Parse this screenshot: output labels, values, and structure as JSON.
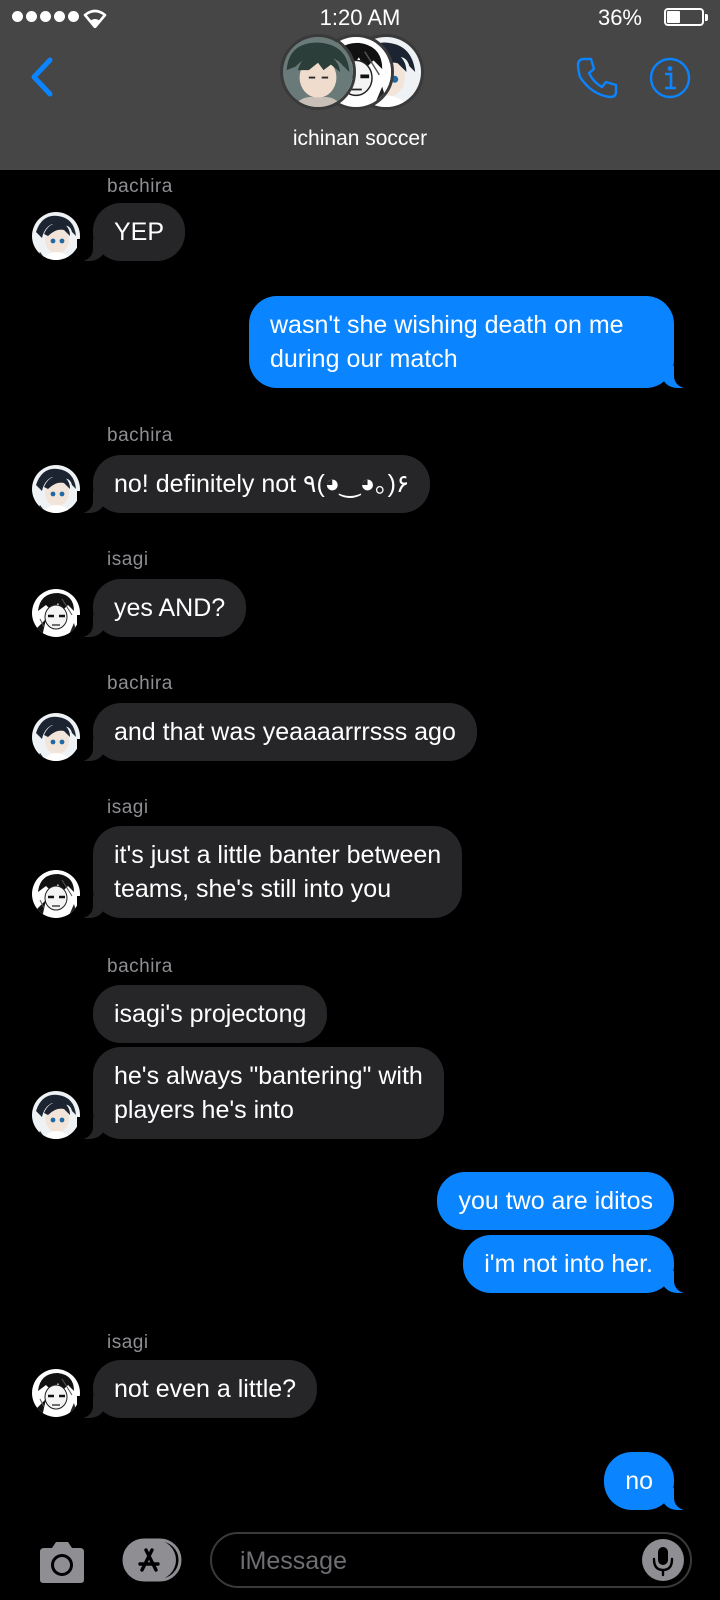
{
  "status_bar": {
    "time": "1:20 AM",
    "battery_percent": "36%"
  },
  "conversation": {
    "title": "ichinan soccer"
  },
  "messages": [
    {
      "sender": "bachira",
      "text": "YEP"
    },
    {
      "text": "wasn't she wishing death on me",
      "text2": "during our match"
    },
    {
      "sender": "bachira",
      "text": "no! definitely not ٩(◕‿◕｡)۶"
    },
    {
      "sender": "isagi",
      "text": "yes AND?"
    },
    {
      "sender": "bachira",
      "text": "and that was yeaaaarrrsss ago"
    },
    {
      "sender": "isagi",
      "text": "it's just a little banter between",
      "text2": "teams, she's still into you"
    },
    {
      "sender": "bachira",
      "text": "isagi's projectong"
    },
    {
      "text": "he's always \"bantering\" with",
      "text2": "players he's into"
    },
    {
      "text": "you two are iditos"
    },
    {
      "text": "i'm not into her."
    },
    {
      "sender": "isagi",
      "text": "not even a little?"
    },
    {
      "text": "no"
    }
  ],
  "compose": {
    "placeholder": "iMessage"
  },
  "icons": {
    "back": "chevron-left-icon",
    "call": "phone-icon",
    "details": "info-icon",
    "camera": "camera-icon",
    "apps": "app-store-icon",
    "dictation": "microphone-icon"
  },
  "colors": {
    "accent": "#0a84ff",
    "incoming_bubble": "#262628",
    "header": "#464646"
  }
}
